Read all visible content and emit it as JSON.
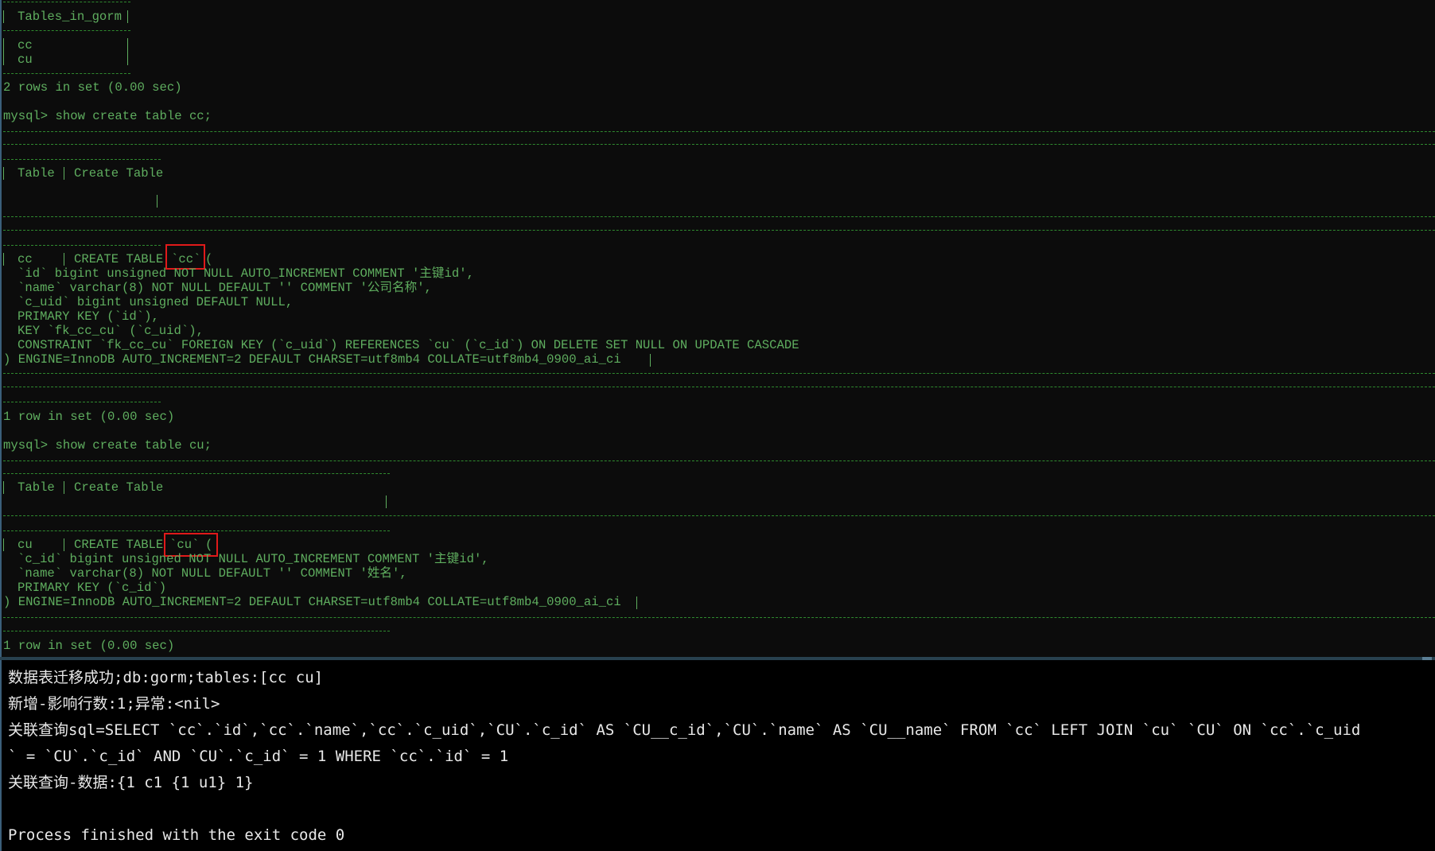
{
  "mysql_output": {
    "tables_header": "Tables_in_gorm",
    "tables": [
      "cc",
      "cu"
    ],
    "tables_footer": "2 rows in set (0.00 sec)",
    "cmd_cc": "mysql> show create table cc;",
    "header_table_col": "Table",
    "header_create_col": "Create Table",
    "cc_name": "cc",
    "create_table_kw": "CREATE TABLE",
    "cc_table_ident": "`cc`",
    "cc_lines": [
      "`id` bigint unsigned NOT NULL AUTO_INCREMENT COMMENT '主键id',",
      "`name` varchar(8) NOT NULL DEFAULT '' COMMENT '公司名称',",
      "`c_uid` bigint unsigned DEFAULT NULL,",
      "PRIMARY KEY (`id`),",
      "KEY `fk_cc_cu` (`c_uid`),",
      "CONSTRAINT `fk_cc_cu` FOREIGN KEY (`c_uid`) REFERENCES `cu` (`c_id`) ON DELETE SET NULL ON UPDATE CASCADE"
    ],
    "cc_engine": ") ENGINE=InnoDB AUTO_INCREMENT=2 DEFAULT CHARSET=utf8mb4 COLLATE=utf8mb4_0900_ai_ci",
    "cc_footer": "1 row in set (0.00 sec)",
    "cmd_cu": "mysql> show create table cu;",
    "cu_name": "cu",
    "cu_table_ident": "`cu`",
    "cu_lines": [
      "`c_id` bigint unsigned NOT NULL AUTO_INCREMENT COMMENT '主键id',",
      "`name` varchar(8) NOT NULL DEFAULT '' COMMENT '姓名',",
      "PRIMARY KEY (`c_id`)"
    ],
    "cu_engine": ") ENGINE=InnoDB AUTO_INCREMENT=2 DEFAULT CHARSET=utf8mb4 COLLATE=utf8mb4_0900_ai_ci",
    "cu_footer": "1 row in set (0.00 sec)"
  },
  "console": {
    "lines": [
      "数据表迁移成功;db:gorm;tables:[cc cu]",
      "新增-影响行数:1;异常:<nil>",
      "关联查询sql=SELECT `cc`.`id`,`cc`.`name`,`cc`.`c_uid`,`CU`.`c_id` AS `CU__c_id`,`CU`.`name` AS `CU__name` FROM `cc` LEFT JOIN `cu` `CU` ON `cc`.`c_uid",
      "` = `CU`.`c_id` AND `CU`.`c_id` = 1 WHERE `cc`.`id` = 1",
      "关联查询-数据:{1 c1 {1 u1} 1}",
      "",
      "Process finished with the exit code 0"
    ]
  },
  "colors": {
    "terminal_green": "#5fae5f",
    "highlight_red": "#e01a1a",
    "console_text": "#e8e8e8"
  }
}
